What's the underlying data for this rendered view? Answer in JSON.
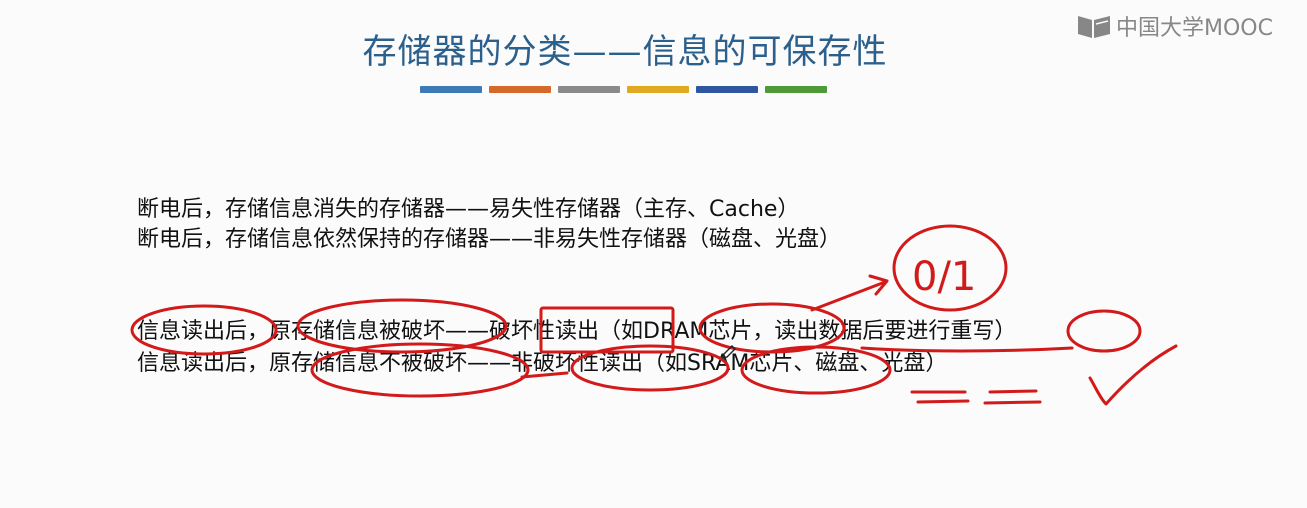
{
  "logo": {
    "text": "中国大学MOOC",
    "icon": "mooc-book-icon"
  },
  "slide": {
    "title": "存储器的分类——信息的可保存性",
    "color_bars": [
      "#3d7ab5",
      "#d4692a",
      "#8a8a8a",
      "#e0a91f",
      "#2f57a0",
      "#4e9a38"
    ],
    "lines": [
      "断电后，存储信息消失的存储器——易失性存储器（主存、Cache）",
      "断电后，存储信息依然保持的存储器——非易失性存储器（磁盘、光盘）",
      "信息读出后，原存储信息被破坏——破坏性读出（如DRAM芯片，读出数据后要进行重写）",
      "信息读出后，原存储信息不被破坏——非破坏性读出（如SRAM芯片、磁盘、光盘）"
    ]
  },
  "annotations": {
    "handwritten_note": "0/1",
    "ink_color": "#d21a1a"
  }
}
